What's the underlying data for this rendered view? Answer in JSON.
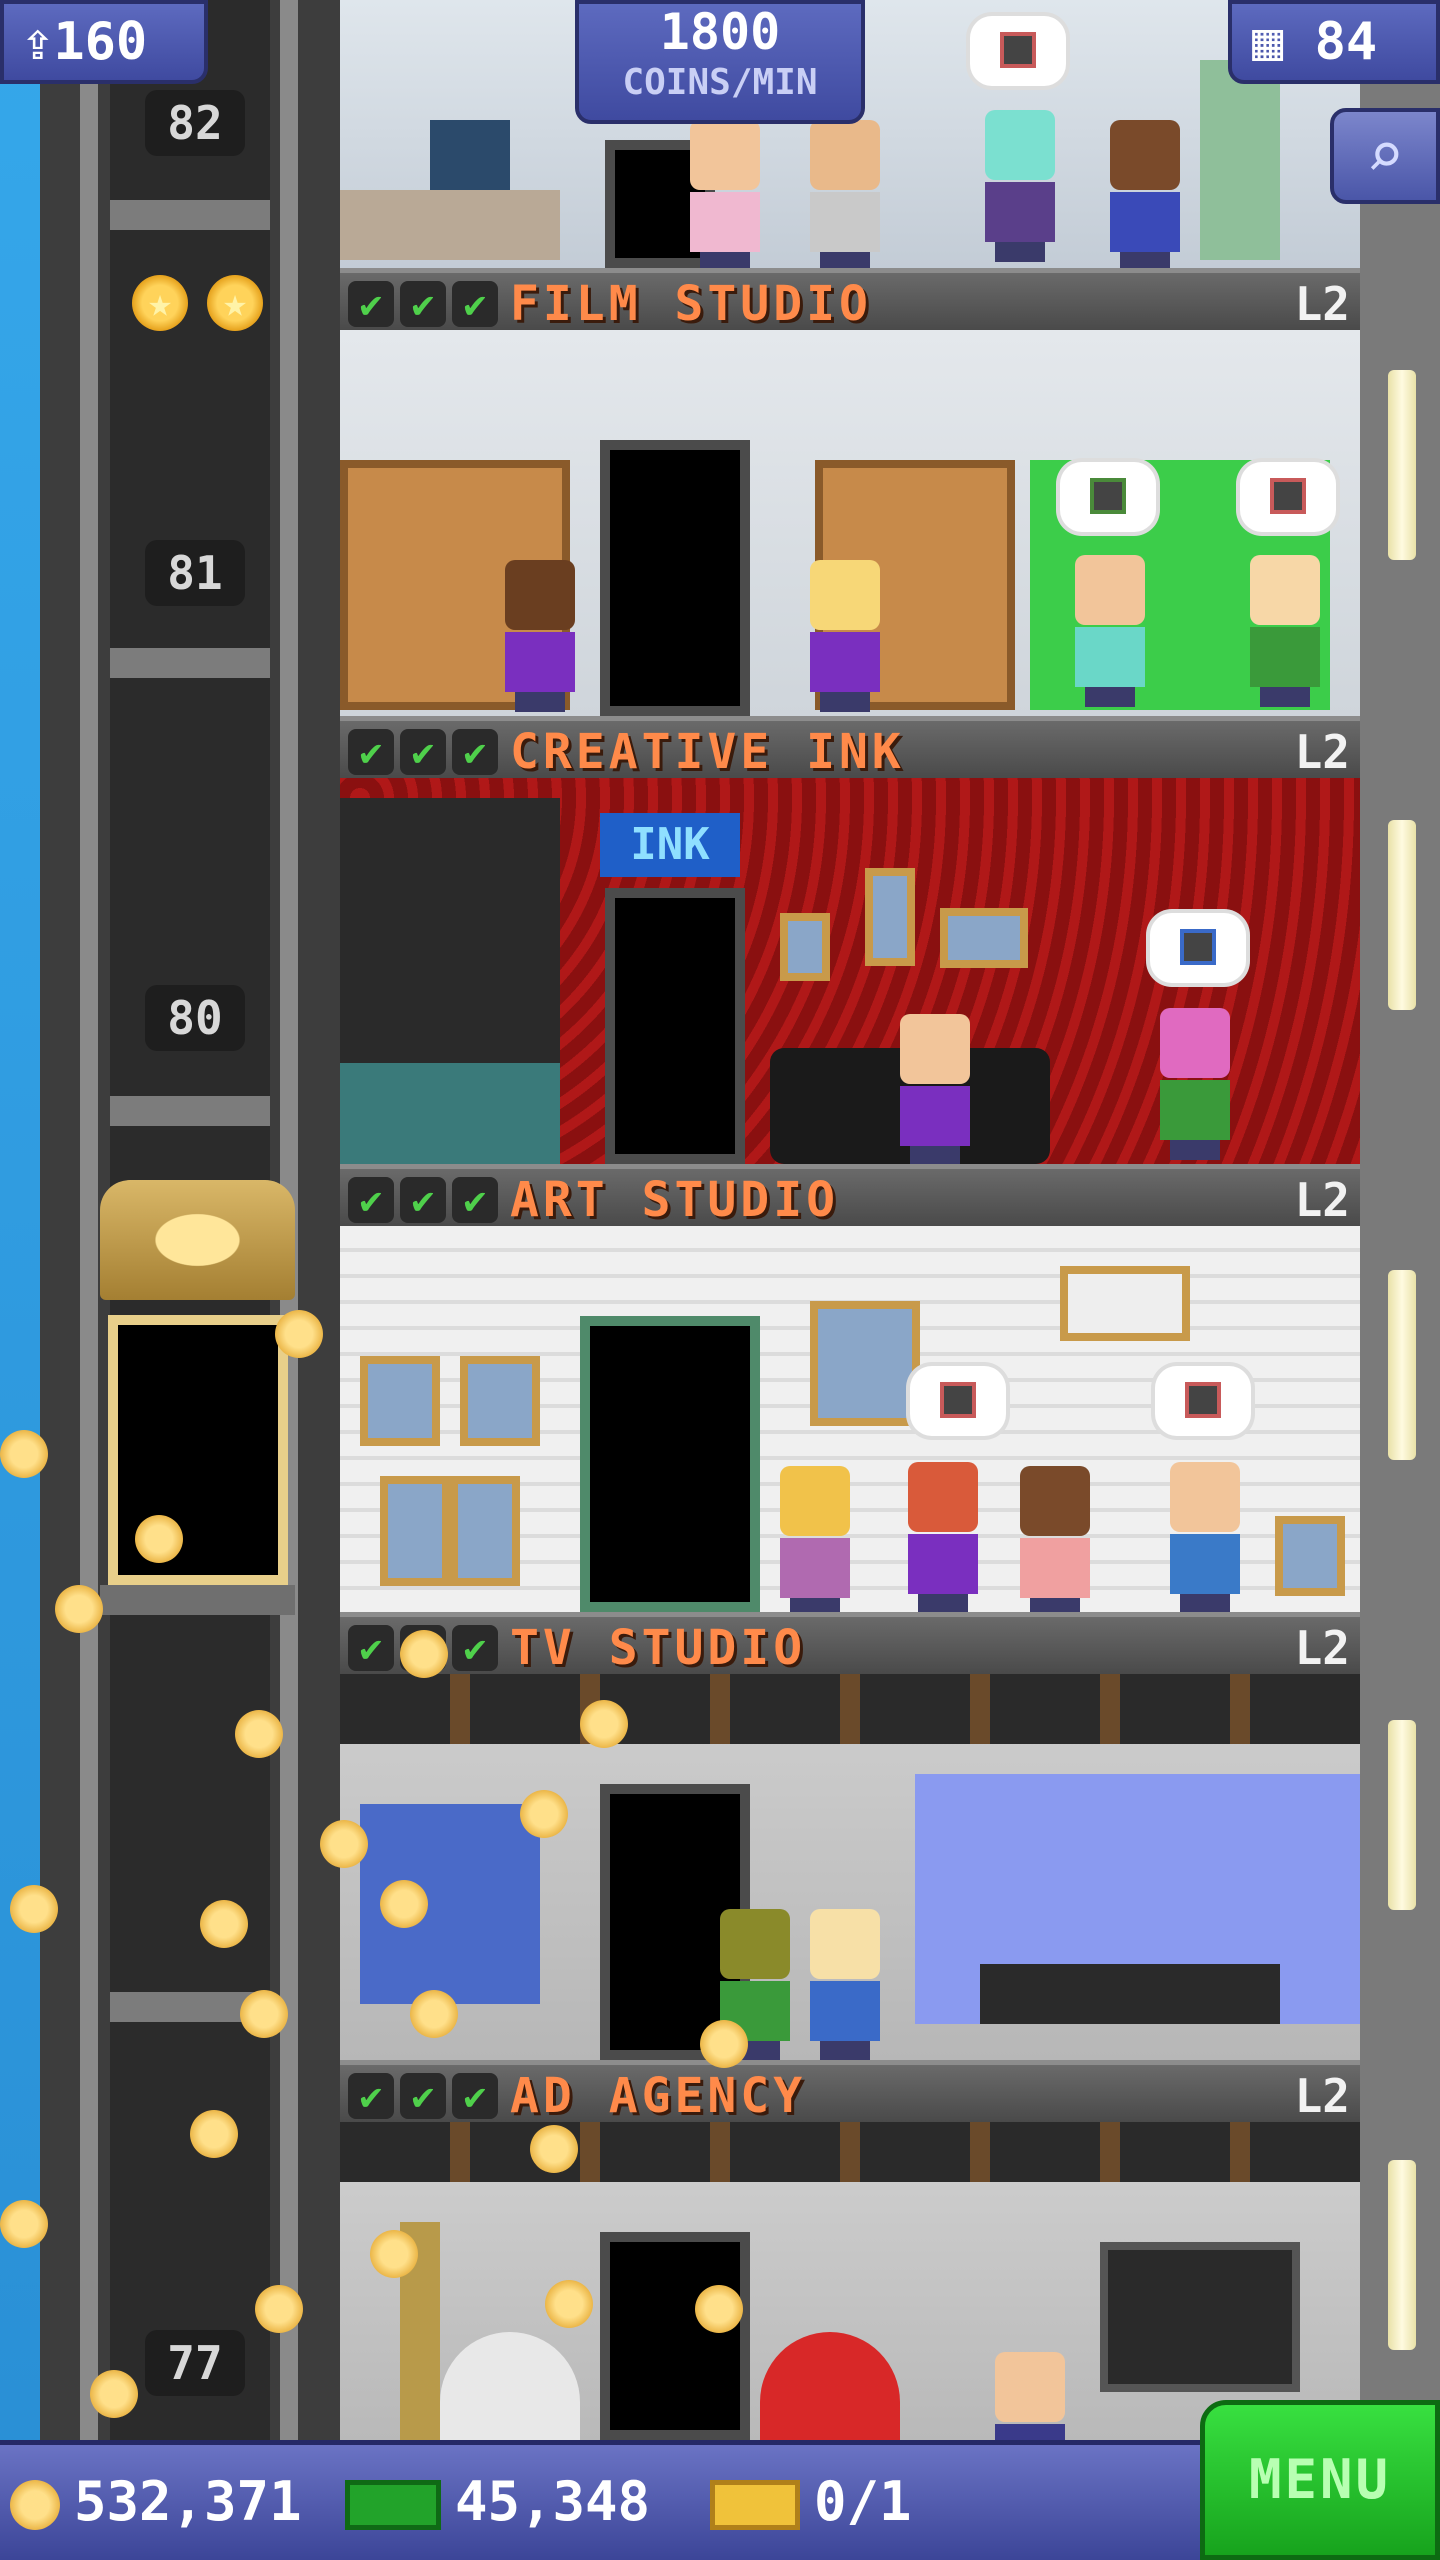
{
  "hud": {
    "population": "160",
    "coin_rate_value": "1800",
    "coin_rate_unit": "COINS/MIN",
    "floor_count": "84"
  },
  "elevator": {
    "floor_numbers": [
      "82",
      "81",
      "80",
      "77"
    ]
  },
  "floors": [
    {
      "name": "FILM STUDIO",
      "level": "L2",
      "checks": 3
    },
    {
      "name": "CREATIVE INK",
      "level": "L2",
      "checks": 3
    },
    {
      "name": "ART STUDIO",
      "level": "L2",
      "checks": 3
    },
    {
      "name": "TV STUDIO",
      "level": "L2",
      "checks": 3
    },
    {
      "name": "AD AGENCY",
      "level": "L2",
      "checks": 3
    }
  ],
  "room_sign": {
    "ink": "INK"
  },
  "bottom": {
    "coins": "532,371",
    "bux": "45,348",
    "tickets": "0/1",
    "menu_label": "MENU"
  },
  "icons": {
    "population": "person-up-icon",
    "floors": "building-icon",
    "search": "magnifier-icon",
    "coins": "coin-icon",
    "bux": "tower-bux-icon",
    "tickets": "vip-ticket-icon",
    "check": "checkmark-icon"
  },
  "colors": {
    "floor_name": "#ff8a4a",
    "check": "#4fd04b",
    "menu": "#2bcf31",
    "hud": "#4f5cb3"
  }
}
